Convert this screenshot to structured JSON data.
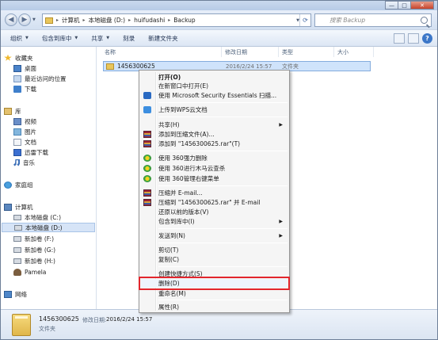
{
  "window": {
    "title": "",
    "buttons": {
      "minimize": "—",
      "maximize": "□",
      "close": "✕"
    }
  },
  "nav": {
    "back": "◀",
    "forward": "▶"
  },
  "address": {
    "segments": [
      "计算机",
      "本地磁盘 (D:)",
      "huifudashi",
      "Backup"
    ],
    "separator": "▸"
  },
  "search": {
    "placeholder": "搜索 Backup"
  },
  "toolbar": {
    "items": [
      {
        "label": "组织"
      },
      {
        "label": "包含到库中"
      },
      {
        "label": "共享"
      },
      {
        "label": "刻录"
      },
      {
        "label": "新建文件夹"
      }
    ],
    "help": "?"
  },
  "sidebar": {
    "items": [
      {
        "label": "收藏夹",
        "icon": "star-icon"
      },
      {
        "label": "桌面",
        "icon": "desktop-icon"
      },
      {
        "label": "最近访问的位置",
        "icon": "recent-places-icon"
      },
      {
        "label": "下载",
        "icon": "download-icon"
      },
      {
        "label": "库",
        "icon": "library-icon"
      },
      {
        "label": "视频",
        "icon": "video-icon"
      },
      {
        "label": "图片",
        "icon": "picture-icon"
      },
      {
        "label": "文档",
        "icon": "document-icon"
      },
      {
        "label": "迅雷下载",
        "icon": "thunder-icon"
      },
      {
        "label": "音乐",
        "icon": "music-icon"
      },
      {
        "label": "家庭组",
        "icon": "homegroup-icon"
      },
      {
        "label": "计算机",
        "icon": "computer-icon"
      },
      {
        "label": "本地磁盘 (C:)",
        "icon": "drive-icon"
      },
      {
        "label": "本地磁盘 (D:)",
        "icon": "drive-icon",
        "selected": true
      },
      {
        "label": "新加卷 (F:)",
        "icon": "drive-icon"
      },
      {
        "label": "新加卷 (G:)",
        "icon": "drive-icon"
      },
      {
        "label": "新加卷 (H:)",
        "icon": "drive-icon"
      },
      {
        "label": "Pamela",
        "icon": "user-icon"
      },
      {
        "label": "网络",
        "icon": "network-icon"
      }
    ]
  },
  "columns": [
    "名称",
    "修改日期",
    "类型",
    "大小"
  ],
  "files": [
    {
      "name": "1456300625",
      "date": "2016/2/24 15:57",
      "type": "文件夹"
    }
  ],
  "context_menu": {
    "items": [
      {
        "label": "打开(O)",
        "bold": true
      },
      {
        "label": "在新窗口中打开(E)"
      },
      {
        "label": "使用 Microsoft Security Essentials 扫描...",
        "icon": "shield-icon"
      },
      {
        "label": "上传到WPS云文档",
        "icon": "cloud-icon"
      },
      {
        "label": "共享(H)",
        "submenu": true
      },
      {
        "label": "添加到压缩文件(A)...",
        "icon": "winrar-icon"
      },
      {
        "label": "添加到 \"1456300625.rar\"(T)",
        "icon": "winrar-icon"
      },
      {
        "label": "使用 360强力删除",
        "icon": "360-icon"
      },
      {
        "label": "使用 360进行木马云查杀",
        "icon": "360-icon"
      },
      {
        "label": "使用 360管理右键菜单",
        "icon": "360-icon"
      },
      {
        "label": "压缩并 E-mail...",
        "icon": "winrar-icon"
      },
      {
        "label": "压缩到 \"1456300625.rar\" 并 E-mail",
        "icon": "winrar-icon"
      },
      {
        "label": "还原以前的版本(V)"
      },
      {
        "label": "包含到库中(I)",
        "submenu": true
      },
      {
        "label": "发送到(N)",
        "submenu": true
      },
      {
        "label": "剪切(T)"
      },
      {
        "label": "复制(C)"
      },
      {
        "label": "创建快捷方式(S)"
      },
      {
        "label": "删除(D)",
        "highlighted": true
      },
      {
        "label": "重命名(M)"
      },
      {
        "label": "属性(R)"
      }
    ]
  },
  "details": {
    "name": "1456300625",
    "meta_label": "修改日期:",
    "meta_value": "2016/2/24 15:57",
    "type": "文件夹"
  },
  "colors": {
    "highlight_box": "#e2262d",
    "selection": "#cfe3fb"
  }
}
